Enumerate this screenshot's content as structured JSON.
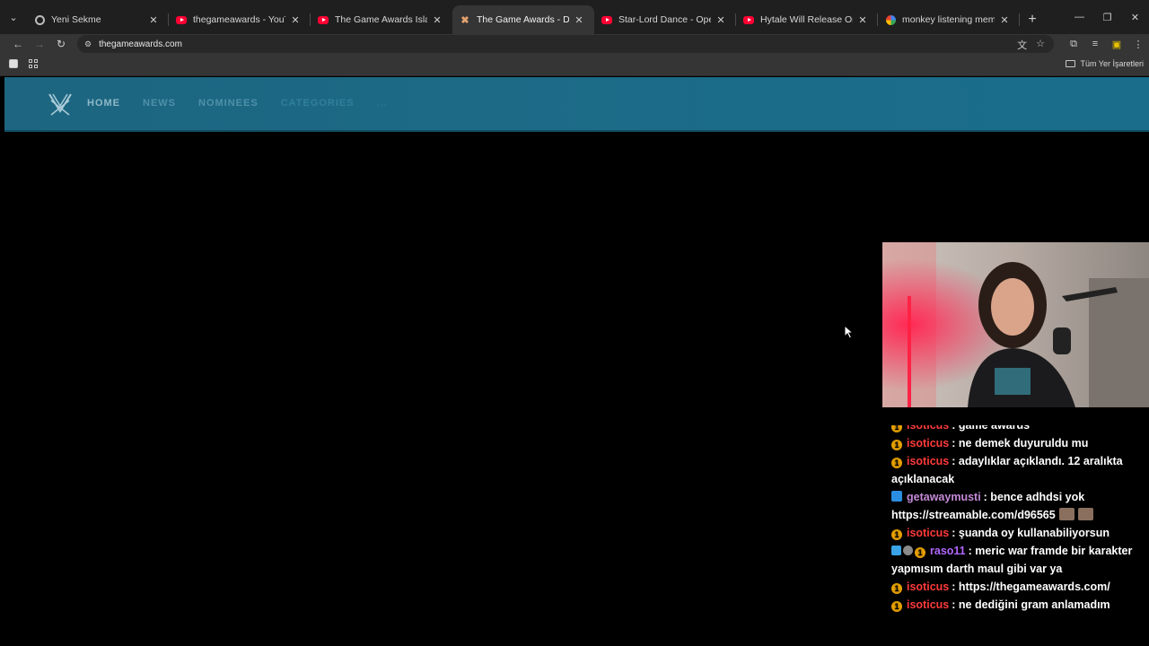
{
  "browser": {
    "tabs": [
      {
        "title": "Yeni Sekme",
        "icon": "chrome-icon",
        "active": false
      },
      {
        "title": "thegameawards - YouTube",
        "icon": "youtube-icon",
        "active": false
      },
      {
        "title": "The Game Awards Island Is Live",
        "icon": "youtube-icon",
        "active": false
      },
      {
        "title": "The Game Awards - December",
        "icon": "game-awards-icon",
        "active": true
      },
      {
        "title": "Star-Lord Dance - Opening Cre",
        "icon": "youtube-icon",
        "active": false
      },
      {
        "title": "Hytale Will Release On January",
        "icon": "youtube-icon",
        "active": false
      },
      {
        "title": "monkey listening meme - Goog",
        "icon": "google-icon",
        "active": false
      }
    ],
    "close_glyph": "✕",
    "url": "thegameawards.com",
    "bookmarks_all": "Tüm Yer İşaretleri"
  },
  "site": {
    "nav": [
      "HOME",
      "NEWS",
      "NOMINEES",
      "CATEGORIES",
      "..."
    ],
    "colors": {
      "header": "#1c6a86",
      "nav_active": "#8fb8c8",
      "nav_faded": "#4f90a8"
    }
  },
  "chat": {
    "messages": [
      {
        "user": "isoticus",
        "color": "#ff3a3a",
        "badge": "bits",
        "text": ": game awards"
      },
      {
        "user": "isoticus",
        "color": "#ff3a3a",
        "badge": "bits",
        "text": ": ne demek duyuruldu mu"
      },
      {
        "user": "isoticus",
        "color": "#ff3a3a",
        "badge": "bits",
        "text": ": adaylıklar açıklandı. 12 aralıkta açıklanacak"
      },
      {
        "user": "getawaymusti",
        "color": "#c48ad8",
        "badge": "prime",
        "text": ": bence adhdsi yok https://streamable.com/d96565",
        "emotes": 2
      },
      {
        "user": "isoticus",
        "color": "#ff3a3a",
        "badge": "bits",
        "text": ": şuanda oy kullanabiliyorsun"
      },
      {
        "user": "raso11",
        "color": "#b266ff",
        "badge": "multi",
        "text": ": meric war framde bir karakter yapmısım darth maul gibi var ya"
      },
      {
        "user": "isoticus",
        "color": "#ff3a3a",
        "badge": "bits",
        "text": ": https://thegameawards.com/"
      },
      {
        "user": "isoticus",
        "color": "#ff3a3a",
        "badge": "bits",
        "text": ": ne dediğini gram anlamadım"
      }
    ]
  }
}
